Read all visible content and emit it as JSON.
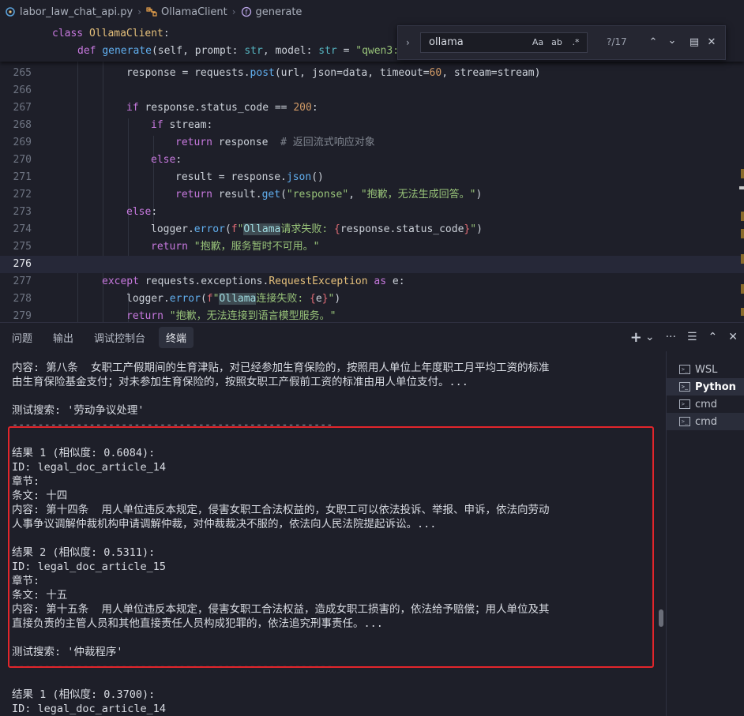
{
  "breadcrumb": {
    "file": "labor_law_chat_api.py",
    "class": "OllamaClient",
    "method": "generate"
  },
  "editor": {
    "sticky": [
      {
        "text": "class OllamaClient:"
      },
      {
        "text": "def generate(self, prompt: str, model: str = \"qwen3:"
      }
    ],
    "lines": [
      {
        "n": "265",
        "text": "response = requests.post(url, json=data, timeout=60, stream=stream)"
      },
      {
        "n": "266",
        "text": ""
      },
      {
        "n": "267",
        "text": "if response.status_code == 200:"
      },
      {
        "n": "268",
        "text": "if stream:"
      },
      {
        "n": "269",
        "text": "return response  # 返回流式响应对象"
      },
      {
        "n": "270",
        "text": "else:"
      },
      {
        "n": "271",
        "text": "result = response.json()"
      },
      {
        "n": "272",
        "text": "return result.get(\"response\", \"抱歉，无法生成回答。\")"
      },
      {
        "n": "273",
        "text": "else:"
      },
      {
        "n": "274",
        "text": "logger.error(f\"Ollama请求失败: {response.status_code}\")"
      },
      {
        "n": "275",
        "text": "return \"抱歉，服务暂时不可用。\""
      },
      {
        "n": "276",
        "text": ""
      },
      {
        "n": "277",
        "text": "except requests.exceptions.RequestException as e:"
      },
      {
        "n": "278",
        "text": "logger.error(f\"Ollama连接失败: {e}\")"
      },
      {
        "n": "279",
        "text": "return \"抱歉，无法连接到语言模型服务。\""
      }
    ]
  },
  "find": {
    "value": "ollama",
    "match_case": "Aa",
    "whole_word": "ab",
    "regex": ".*",
    "count": "?/17"
  },
  "panel": {
    "tabs": [
      "问题",
      "输出",
      "调试控制台",
      "终端"
    ],
    "active_tab": "终端",
    "terminals": [
      "WSL",
      "Python",
      "cmd",
      "cmd"
    ]
  },
  "terminal": {
    "lines": [
      "内容: 第八条  女职工产假期间的生育津贴，对已经参加生育保险的，按照用人单位上年度职工月平均工资的标准",
      "由生育保险基金支付；对未参加生育保险的，按照女职工产假前工资的标准由用人单位支付。...",
      "",
      "测试搜索: '劳动争议处理'",
      "--------------------------------------------------",
      "",
      "结果 1 (相似度: 0.6084):",
      "ID: legal_doc_article_14",
      "章节:",
      "条文: 十四",
      "内容: 第十四条  用人单位违反本规定，侵害女职工合法权益的，女职工可以依法投诉、举报、申诉，依法向劳动",
      "人事争议调解仲裁机构申请调解仲裁，对仲裁裁决不服的，依法向人民法院提起诉讼。...",
      "",
      "结果 2 (相似度: 0.5311):",
      "ID: legal_doc_article_15",
      "章节:",
      "条文: 十五",
      "内容: 第十五条  用人单位违反本规定，侵害女职工合法权益，造成女职工损害的，依法给予赔偿；用人单位及其",
      "直接负责的主管人员和其他直接责任人员构成犯罪的，依法追究刑事责任。...",
      "",
      "测试搜索: '仲裁程序'",
      "--------------------------------------------------",
      "",
      "结果 1 (相似度: 0.3700):",
      "ID: legal_doc_article_14"
    ]
  }
}
